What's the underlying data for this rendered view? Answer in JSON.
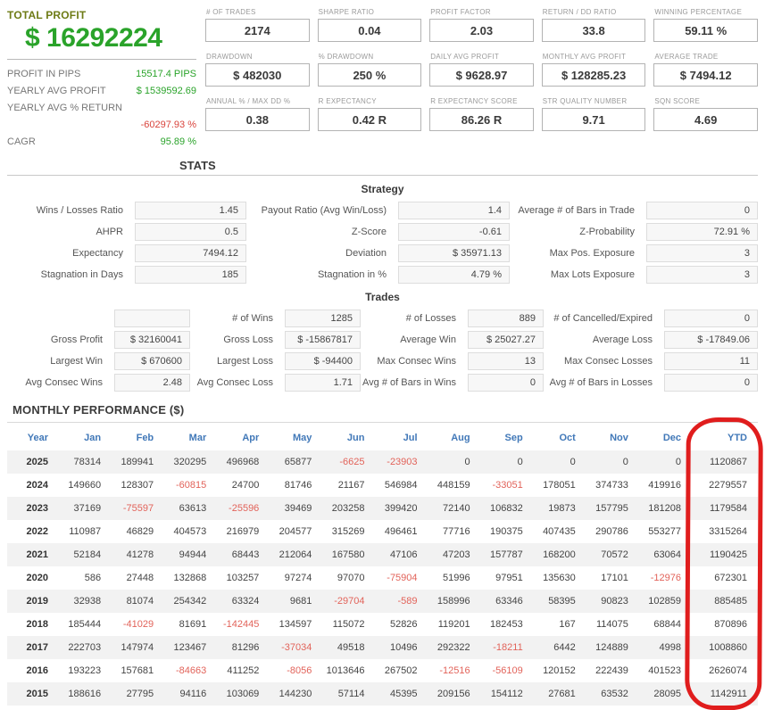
{
  "colors": {
    "accent_green": "#2aa32a",
    "negative_red": "#d9443c",
    "table_negative_red": "#e2635a",
    "olive_title": "#6e7b16",
    "table_header_blue": "#4178b8",
    "annotation_red": "#e01d1d"
  },
  "summary": {
    "title": "TOTAL PROFIT",
    "total_profit": "$ 16292224",
    "rows": [
      {
        "label": "PROFIT IN PIPS",
        "value": "15517.4 PIPS",
        "color": "green",
        "wrap": false
      },
      {
        "label": "YEARLY AVG PROFIT",
        "value": "$ 1539592.69",
        "color": "green",
        "wrap": false
      },
      {
        "label": "YEARLY AVG % RETURN",
        "value": "-60297.93 %",
        "color": "red",
        "wrap": true
      },
      {
        "label": "CAGR",
        "value": "95.89 %",
        "color": "green",
        "wrap": false
      }
    ]
  },
  "kpis": [
    {
      "label": "# OF TRADES",
      "value": "2174"
    },
    {
      "label": "SHARPE RATIO",
      "value": "0.04"
    },
    {
      "label": "PROFIT FACTOR",
      "value": "2.03"
    },
    {
      "label": "RETURN / DD RATIO",
      "value": "33.8"
    },
    {
      "label": "WINNING PERCENTAGE",
      "value": "59.11 %"
    },
    {
      "label": "DRAWDOWN",
      "value": "$ 482030"
    },
    {
      "label": "% DRAWDOWN",
      "value": "250 %"
    },
    {
      "label": "DAILY AVG PROFIT",
      "value": "$ 9628.97"
    },
    {
      "label": "MONTHLY AVG PROFIT",
      "value": "$ 128285.23"
    },
    {
      "label": "AVERAGE TRADE",
      "value": "$ 7494.12"
    },
    {
      "label": "ANNUAL % / MAX DD %",
      "value": "0.38"
    },
    {
      "label": "R EXPECTANCY",
      "value": "0.42 R"
    },
    {
      "label": "R EXPECTANCY SCORE",
      "value": "86.26 R"
    },
    {
      "label": "STR QUALITY NUMBER",
      "value": "9.71"
    },
    {
      "label": "SQN SCORE",
      "value": "4.69"
    }
  ],
  "stats": {
    "heading": "STATS",
    "strategy": {
      "heading": "Strategy",
      "pairs": [
        {
          "label": "Wins / Losses Ratio",
          "value": "1.45"
        },
        {
          "label": "Payout Ratio (Avg Win/Loss)",
          "value": "1.4"
        },
        {
          "label": "Average # of Bars in Trade",
          "value": "0"
        },
        {
          "label": "AHPR",
          "value": "0.5"
        },
        {
          "label": "Z-Score",
          "value": "-0.61"
        },
        {
          "label": "Z-Probability",
          "value": "72.91 %"
        },
        {
          "label": "Expectancy",
          "value": "7494.12"
        },
        {
          "label": "Deviation",
          "value": "$ 35971.13"
        },
        {
          "label": "Max Pos. Exposure",
          "value": "3"
        },
        {
          "label": "Stagnation in Days",
          "value": "185"
        },
        {
          "label": "Stagnation in %",
          "value": "4.79 %"
        },
        {
          "label": "Max Lots Exposure",
          "value": "3"
        }
      ]
    },
    "trades": {
      "heading": "Trades",
      "pairs": [
        {
          "label": "",
          "value": ""
        },
        {
          "label": "# of Wins",
          "value": "1285"
        },
        {
          "label": "# of Losses",
          "value": "889"
        },
        {
          "label": "# of Cancelled/Expired",
          "value": "0"
        },
        {
          "label": "Gross Profit",
          "value": "$ 32160041"
        },
        {
          "label": "Gross Loss",
          "value": "$ -15867817"
        },
        {
          "label": "Average Win",
          "value": "$ 25027.27"
        },
        {
          "label": "Average Loss",
          "value": "$ -17849.06"
        },
        {
          "label": "Largest Win",
          "value": "$ 670600"
        },
        {
          "label": "Largest Loss",
          "value": "$ -94400"
        },
        {
          "label": "Max Consec Wins",
          "value": "13"
        },
        {
          "label": "Max Consec Losses",
          "value": "11"
        },
        {
          "label": "Avg Consec Wins",
          "value": "2.48"
        },
        {
          "label": "Avg Consec Loss",
          "value": "1.71"
        },
        {
          "label": "Avg # of Bars in Wins",
          "value": "0"
        },
        {
          "label": "Avg # of Bars in Losses",
          "value": "0"
        }
      ]
    }
  },
  "monthly": {
    "heading": "MONTHLY PERFORMANCE ($)",
    "columns": [
      "Year",
      "Jan",
      "Feb",
      "Mar",
      "Apr",
      "May",
      "Jun",
      "Jul",
      "Aug",
      "Sep",
      "Oct",
      "Nov",
      "Dec",
      "YTD"
    ],
    "rows": [
      {
        "year": "2025",
        "values": [
          78314,
          189941,
          320295,
          496968,
          65877,
          -6625,
          -23903,
          0,
          0,
          0,
          0,
          0
        ],
        "ytd": 1120867
      },
      {
        "year": "2024",
        "values": [
          149660,
          128307,
          -60815,
          24700,
          81746,
          21167,
          546984,
          448159,
          -33051,
          178051,
          374733,
          419916
        ],
        "ytd": 2279557
      },
      {
        "year": "2023",
        "values": [
          37169,
          -75597,
          63613,
          -25596,
          39469,
          203258,
          399420,
          72140,
          106832,
          19873,
          157795,
          181208
        ],
        "ytd": 1179584
      },
      {
        "year": "2022",
        "values": [
          110987,
          46829,
          404573,
          216979,
          204577,
          315269,
          496461,
          77716,
          190375,
          407435,
          290786,
          553277
        ],
        "ytd": 3315264
      },
      {
        "year": "2021",
        "values": [
          52184,
          41278,
          94944,
          68443,
          212064,
          167580,
          47106,
          47203,
          157787,
          168200,
          70572,
          63064
        ],
        "ytd": 1190425
      },
      {
        "year": "2020",
        "values": [
          586,
          27448,
          132868,
          103257,
          97274,
          97070,
          -75904,
          51996,
          97951,
          135630,
          17101,
          -12976
        ],
        "ytd": 672301
      },
      {
        "year": "2019",
        "values": [
          32938,
          81074,
          254342,
          63324,
          9681,
          -29704,
          -589,
          158996,
          63346,
          58395,
          90823,
          102859
        ],
        "ytd": 885485
      },
      {
        "year": "2018",
        "values": [
          185444,
          -41029,
          81691,
          -142445,
          134597,
          115072,
          52826,
          119201,
          182453,
          167,
          114075,
          68844
        ],
        "ytd": 870896
      },
      {
        "year": "2017",
        "values": [
          222703,
          147974,
          123467,
          81296,
          -37034,
          49518,
          10496,
          292322,
          -18211,
          6442,
          124889,
          4998
        ],
        "ytd": 1008860
      },
      {
        "year": "2016",
        "values": [
          193223,
          157681,
          -84663,
          411252,
          -8056,
          1013646,
          267502,
          -12516,
          -56109,
          120152,
          222439,
          401523
        ],
        "ytd": 2626074
      },
      {
        "year": "2015",
        "values": [
          188616,
          27795,
          94116,
          103069,
          144230,
          57114,
          45395,
          209156,
          154112,
          27681,
          63532,
          28095
        ],
        "ytd": 1142911
      }
    ]
  }
}
